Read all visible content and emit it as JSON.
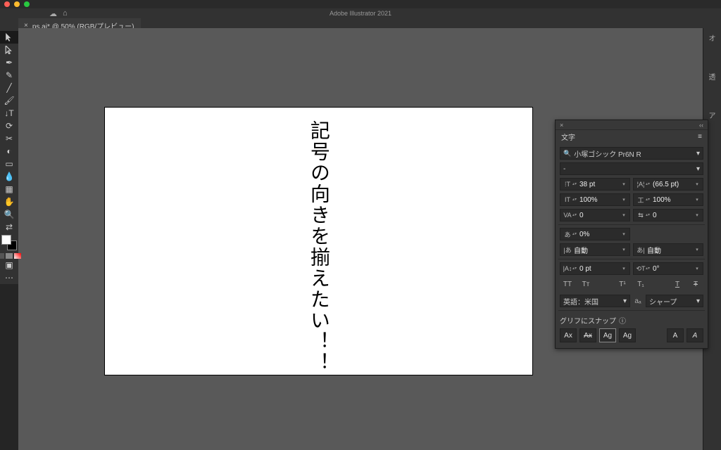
{
  "colors": {
    "red": "#ff5f57",
    "yellow": "#febc2e",
    "green": "#28c840"
  },
  "app_title": "Adobe Illustrator 2021",
  "tab": {
    "label": "ps.ai* @ 50% (RGB/プレビュー)",
    "close": "×"
  },
  "canvas": {
    "text": "記号の向きを揃えたい！！"
  },
  "panel": {
    "title": "文字",
    "close": "×",
    "menu": "≡",
    "collapse": "‹‹",
    "font_search_icon": "🔍",
    "font": "小塚ゴシック Pr6N R",
    "style": "-",
    "size": {
      "icon": "⁞T",
      "val": "38 pt"
    },
    "leading": {
      "icon": "¦A¦",
      "val": "(66.5 pt)"
    },
    "hscale": {
      "icon": "IT",
      "val": "100%"
    },
    "vscale": {
      "icon": "工",
      "val": "100%"
    },
    "kerning": {
      "icon": "VA",
      "val": "0"
    },
    "tracking": {
      "icon": "⇆",
      "val": "0"
    },
    "tsume": {
      "icon": "あ",
      "val": "0%"
    },
    "aki_l": {
      "icon": "|あ",
      "val": "自動"
    },
    "aki_r": {
      "icon": "あ|",
      "val": "自動"
    },
    "baseline": {
      "icon": "|A↕",
      "val": "0 pt"
    },
    "rotate": {
      "icon": "⟲T",
      "val": "0°"
    },
    "caps": [
      "TT",
      "Tᴛ",
      "T¹",
      "T₁",
      "T",
      "Ŧ"
    ],
    "lang": "英語：米国",
    "aa_icon": "aₐ",
    "aa": "シャープ",
    "snap_label": "グリフにスナップ",
    "snap_info": "ⓘ",
    "glyphs": [
      "Ax",
      "Ax",
      "Ag",
      "Ag",
      "A",
      "A"
    ]
  },
  "right_tabs": [
    "オ",
    "透",
    "ア"
  ]
}
